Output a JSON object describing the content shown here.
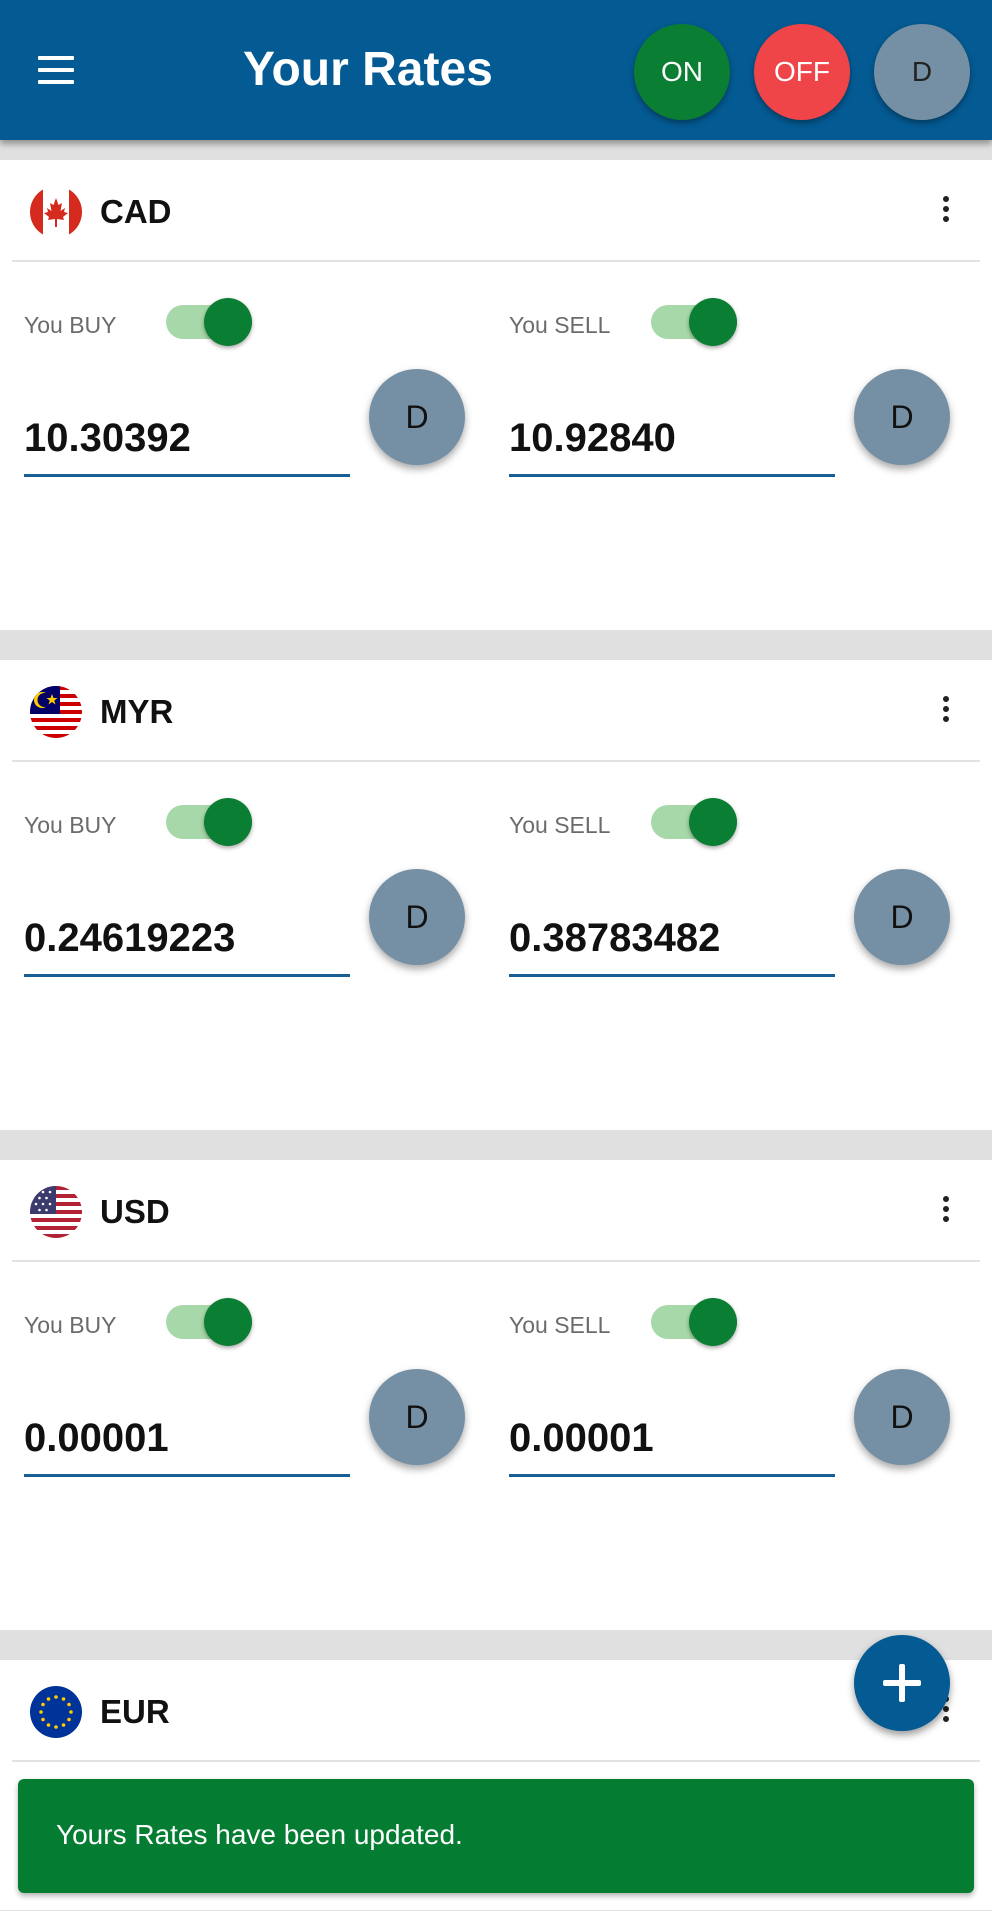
{
  "app_bar": {
    "title": "Your Rates",
    "on_label": "ON",
    "off_label": "OFF",
    "d_label": "D",
    "colors": {
      "bar": "#045a92",
      "on": "#0a7e32",
      "off": "#ef4448",
      "d": "#7590a4"
    }
  },
  "currencies": [
    {
      "code": "CAD",
      "flag_icon": "canada-flag-icon",
      "buy": {
        "label": "You BUY",
        "enabled": true,
        "rate": "10.30392",
        "d_label": "D"
      },
      "sell": {
        "label": "You SELL",
        "enabled": true,
        "rate": "10.92840",
        "d_label": "D"
      }
    },
    {
      "code": "MYR",
      "flag_icon": "malaysia-flag-icon",
      "buy": {
        "label": "You BUY",
        "enabled": true,
        "rate": "0.24619223",
        "d_label": "D"
      },
      "sell": {
        "label": "You SELL",
        "enabled": true,
        "rate": "0.38783482",
        "d_label": "D"
      }
    },
    {
      "code": "USD",
      "flag_icon": "usa-flag-icon",
      "buy": {
        "label": "You BUY",
        "enabled": true,
        "rate": "0.00001",
        "d_label": "D"
      },
      "sell": {
        "label": "You SELL",
        "enabled": true,
        "rate": "0.00001",
        "d_label": "D"
      }
    },
    {
      "code": "EUR",
      "flag_icon": "eu-flag-icon"
    }
  ],
  "fab_icon": "plus-icon",
  "snackbar": {
    "message": "Yours Rates have been updated.",
    "color": "#047d33"
  }
}
